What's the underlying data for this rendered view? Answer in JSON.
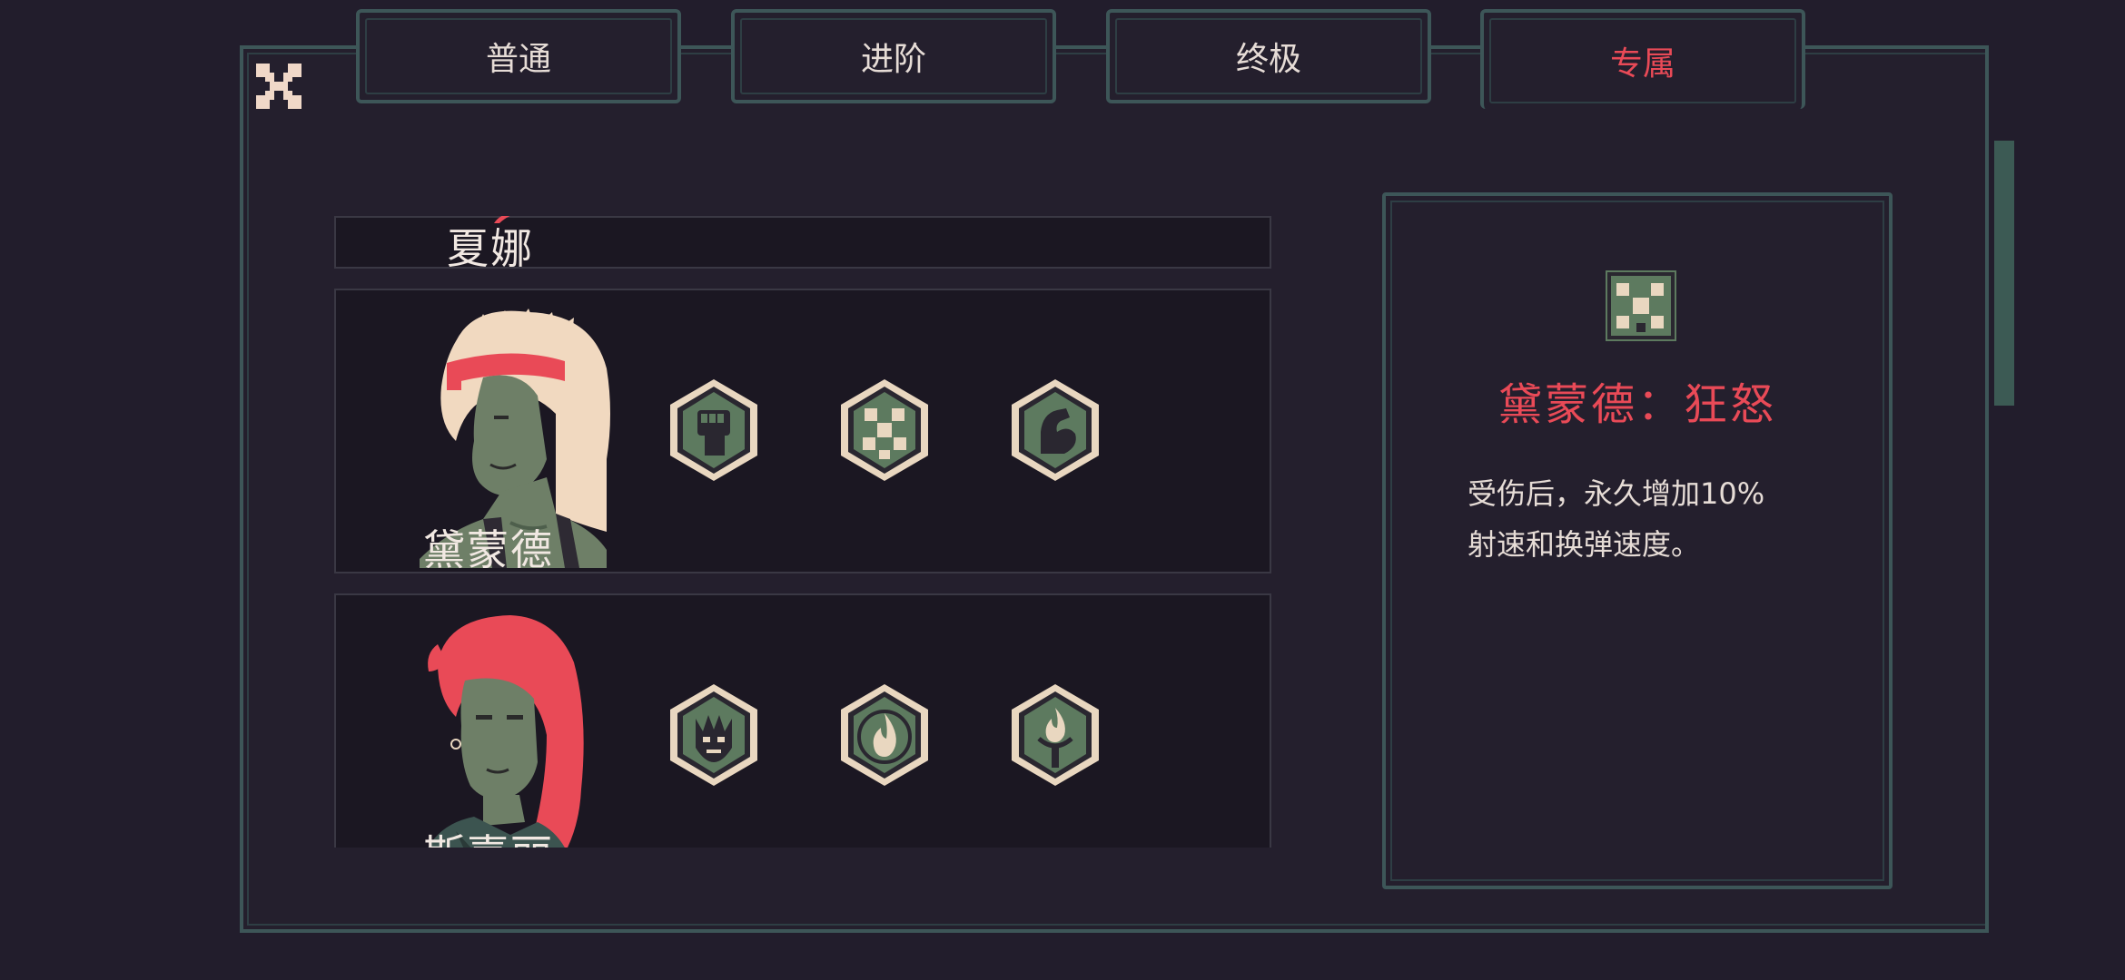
{
  "tabs": [
    {
      "label": "普通",
      "active": false
    },
    {
      "label": "进阶",
      "active": false
    },
    {
      "label": "终极",
      "active": false
    },
    {
      "label": "专属",
      "active": true
    }
  ],
  "characters": [
    {
      "name": "夏娜",
      "skills": []
    },
    {
      "name": "黛蒙德",
      "skills": [
        "fist-icon",
        "rage-cubes-icon",
        "flexed-arm-icon"
      ]
    },
    {
      "name": "斯嘉丽",
      "skills": [
        "flame-skull-icon",
        "fire-icon",
        "torch-icon"
      ]
    }
  ],
  "detail": {
    "icon": "rage-cubes-icon",
    "title": "黛蒙德：狂怒",
    "desc_line1": "受伤后，永久增加10%",
    "desc_line2": "射速和换弹速度。"
  },
  "colors": {
    "background": "#221d2c",
    "frame": "#3d5658",
    "accent": "#e94a57",
    "text": "#e6dcd6",
    "icon_green": "#5d7a5f",
    "icon_light": "#e9d7c0"
  }
}
